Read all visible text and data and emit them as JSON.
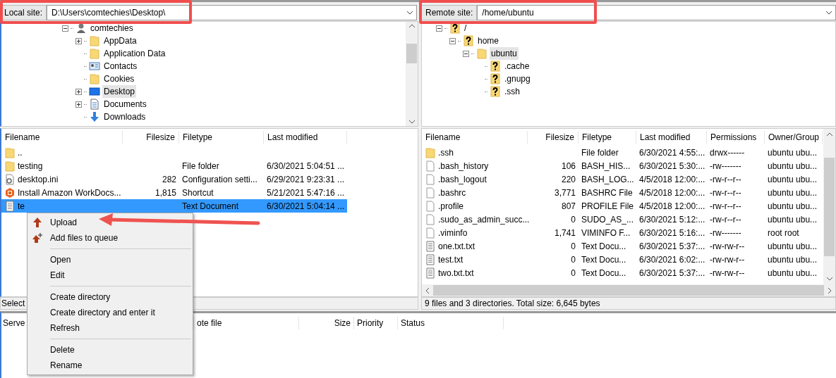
{
  "local_site": {
    "label": "Local site:",
    "path": "D:\\Users\\comtechies\\Desktop\\"
  },
  "remote_site": {
    "label": "Remote site:",
    "path": "/home/ubuntu"
  },
  "local_tree": [
    {
      "label": "comtechies",
      "kind": "user",
      "expanded": true,
      "selected": false,
      "children": [
        {
          "label": "AppData",
          "kind": "folder",
          "expanded": false,
          "selected": false
        },
        {
          "label": "Application Data",
          "kind": "folder",
          "selected": false
        },
        {
          "label": "Contacts",
          "kind": "contacts",
          "selected": false
        },
        {
          "label": "Cookies",
          "kind": "folder",
          "selected": false
        },
        {
          "label": "Desktop",
          "kind": "desktop",
          "expanded": false,
          "selected": true
        },
        {
          "label": "Documents",
          "kind": "documents",
          "expanded": false,
          "selected": false
        },
        {
          "label": "Downloads",
          "kind": "download",
          "selected": false
        }
      ]
    }
  ],
  "remote_tree": [
    {
      "label": "/",
      "kind": "unknown",
      "expanded": true,
      "selected": false,
      "children": [
        {
          "label": "home",
          "kind": "unknown",
          "expanded": true,
          "selected": false,
          "children": [
            {
              "label": "ubuntu",
              "kind": "folder",
              "expanded": true,
              "selected": true,
              "children": [
                {
                  "label": ".cache",
                  "kind": "unknown",
                  "selected": false
                },
                {
                  "label": ".gnupg",
                  "kind": "unknown",
                  "selected": false
                },
                {
                  "label": ".ssh",
                  "kind": "unknown",
                  "selected": false
                }
              ]
            }
          ]
        }
      ]
    }
  ],
  "local_files": {
    "columns": [
      "Filename",
      "Filesize",
      "Filetype",
      "Last modified"
    ],
    "rows": [
      {
        "kind": "folder",
        "cells": [
          "..",
          "",
          "",
          ""
        ],
        "selected": false
      },
      {
        "kind": "folder",
        "cells": [
          "testing",
          "",
          "File folder",
          "6/30/2021 5:04:51 ..."
        ],
        "selected": false
      },
      {
        "kind": "config",
        "cells": [
          "desktop.ini",
          "282",
          "Configuration setti...",
          "6/29/2021 9:23:31 ..."
        ],
        "selected": false
      },
      {
        "kind": "shortcut",
        "cells": [
          "Install Amazon WorkDocs...",
          "1,815",
          "Shortcut",
          "5/21/2021 5:47:16 ..."
        ],
        "selected": false
      },
      {
        "kind": "text",
        "cells": [
          "te",
          "",
          "Text Document",
          "6/30/2021 5:04:14 ..."
        ],
        "selected": true
      }
    ],
    "status": "Select"
  },
  "remote_files": {
    "columns": [
      "Filename",
      "Filesize",
      "Filetype",
      "Last modified",
      "Permissions",
      "Owner/Group"
    ],
    "rows": [
      {
        "kind": "folder",
        "cells": [
          ".ssh",
          "",
          "File folder",
          "6/30/2021 4:55:...",
          "drwx------",
          "ubuntu ubu..."
        ],
        "selected": false
      },
      {
        "kind": "file",
        "cells": [
          ".bash_history",
          "106",
          "BASH_HIS...",
          "6/30/2021 5:30:...",
          "-rw-------",
          "ubuntu ubu..."
        ],
        "selected": false
      },
      {
        "kind": "file",
        "cells": [
          ".bash_logout",
          "220",
          "BASH_LOG...",
          "4/5/2018 12:00:...",
          "-rw-r--r--",
          "ubuntu ubu..."
        ],
        "selected": false
      },
      {
        "kind": "file",
        "cells": [
          ".bashrc",
          "3,771",
          "BASHRC File",
          "4/5/2018 12:00:...",
          "-rw-r--r--",
          "ubuntu ubu..."
        ],
        "selected": false
      },
      {
        "kind": "file",
        "cells": [
          ".profile",
          "807",
          "PROFILE File",
          "4/5/2018 12:00:...",
          "-rw-r--r--",
          "ubuntu ubu..."
        ],
        "selected": false
      },
      {
        "kind": "file",
        "cells": [
          ".sudo_as_admin_succ...",
          "0",
          "SUDO_AS_...",
          "6/30/2021 5:12:...",
          "-rw-r--r--",
          "ubuntu ubu..."
        ],
        "selected": false
      },
      {
        "kind": "file",
        "cells": [
          ".viminfo",
          "1,741",
          "VIMINFO F...",
          "6/30/2021 5:16:...",
          "-rw-------",
          "root root"
        ],
        "selected": false
      },
      {
        "kind": "text",
        "cells": [
          "one.txt.txt",
          "0",
          "Text Docu...",
          "6/30/2021 5:37:...",
          "-rw-rw-r--",
          "ubuntu ubu..."
        ],
        "selected": false
      },
      {
        "kind": "text",
        "cells": [
          "test.txt",
          "0",
          "Text Docu...",
          "6/30/2021 6:02:...",
          "-rw-rw-r--",
          "ubuntu ubu..."
        ],
        "selected": false
      },
      {
        "kind": "text",
        "cells": [
          "two.txt.txt",
          "0",
          "Text Docu...",
          "6/30/2021 5:37:...",
          "-rw-rw-r--",
          "ubuntu ubu..."
        ],
        "selected": false
      }
    ],
    "status": "9 files and 3 directories. Total size: 6,645 bytes"
  },
  "queue": {
    "columns": [
      "Serve",
      "ote file",
      "Size",
      "Priority",
      "Status"
    ]
  },
  "context_menu": [
    {
      "kind": "upload",
      "label": "Upload"
    },
    {
      "kind": "queue",
      "label": "Add files to queue"
    },
    {
      "kind": "separator"
    },
    {
      "kind": "plain",
      "label": "Open"
    },
    {
      "kind": "plain",
      "label": "Edit"
    },
    {
      "kind": "separator"
    },
    {
      "kind": "plain",
      "label": "Create directory"
    },
    {
      "kind": "plain",
      "label": "Create directory and enter it"
    },
    {
      "kind": "plain",
      "label": "Refresh"
    },
    {
      "kind": "separator"
    },
    {
      "kind": "plain",
      "label": "Delete"
    },
    {
      "kind": "plain",
      "label": "Rename"
    }
  ]
}
